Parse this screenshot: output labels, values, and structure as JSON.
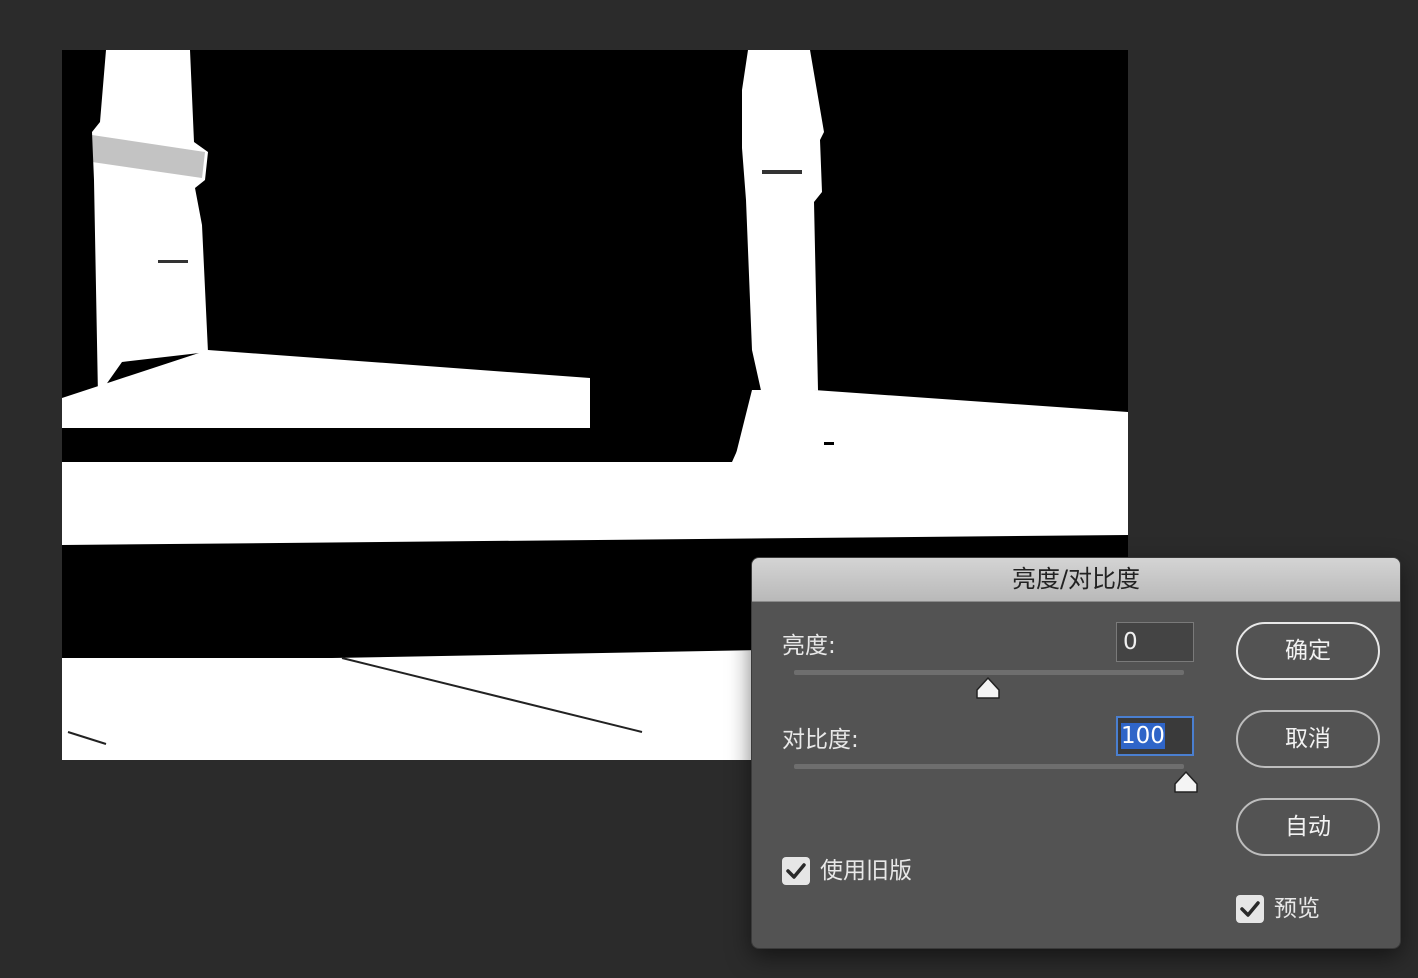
{
  "dialog": {
    "title": "亮度/对比度",
    "brightness": {
      "label": "亮度:",
      "value": "0",
      "slider_level": 0.5
    },
    "contrast": {
      "label": "对比度:",
      "value": "100",
      "slider_level": 1.0
    },
    "buttons": {
      "ok": "确定",
      "cancel": "取消",
      "auto": "自动"
    },
    "use_legacy": {
      "label": "使用旧版",
      "checked": true
    },
    "preview": {
      "label": "预览",
      "checked": true
    }
  },
  "canvas": {
    "content": "high-contrast black and white photo of pillars and steps"
  }
}
